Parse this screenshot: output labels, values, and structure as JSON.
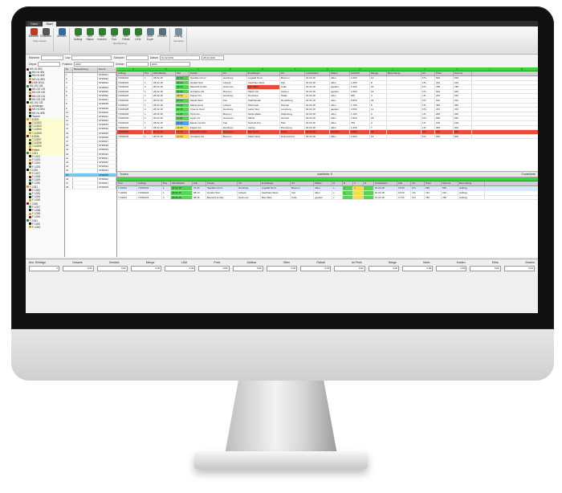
{
  "app": {
    "tabs": [
      "Datei",
      "Start"
    ],
    "active_tab": 1
  },
  "ribbon": {
    "groups": [
      {
        "name": "Stammdaten",
        "buttons": [
          {
            "label": "Benutzer",
            "icon": "user-icon",
            "color": "#c0392b"
          },
          {
            "label": "Einstellen",
            "icon": "settings-icon",
            "color": "#555555"
          }
        ]
      },
      {
        "name": "",
        "buttons": [
          {
            "label": "Abholen",
            "icon": "truck-icon",
            "color": "#2e6da4"
          }
        ]
      },
      {
        "name": "Bearbeitung",
        "buttons": [
          {
            "label": "Neu Auftrag",
            "icon": "truck-add-icon",
            "color": "#2e7d32"
          },
          {
            "label": "Neu Status",
            "icon": "truck-status-icon",
            "color": "#2e7d32"
          },
          {
            "label": "Neu Kunden",
            "icon": "truck-customer-icon",
            "color": "#2e7d32"
          },
          {
            "label": "Neu Tour",
            "icon": "truck-tour-icon",
            "color": "#2e7d32"
          },
          {
            "label": "Neu Fahrer",
            "icon": "truck-driver-icon",
            "color": "#2e7d32"
          },
          {
            "label": "Neu LKW",
            "icon": "truck-lkw-icon",
            "color": "#2e7d32"
          },
          {
            "label": "Auftr. Kopie",
            "icon": "copy-icon",
            "color": "#607d8b"
          },
          {
            "label": "Drucken",
            "icon": "print-icon",
            "color": "#546e7a"
          }
        ]
      },
      {
        "name": "Verwalten",
        "buttons": [
          {
            "label": "Auftrag",
            "icon": "tools-icon",
            "color": "#78909c"
          }
        ]
      }
    ]
  },
  "filters": {
    "row1": [
      {
        "label": "Rahmen",
        "value": ""
      },
      {
        "label": "Lkw",
        "value": ""
      },
      {
        "label": "Standort",
        "value": ""
      },
      {
        "label": "Datum",
        "value": "01.02.2019"
      },
      {
        "label": "",
        "value": "28.02.2019"
      }
    ],
    "row2": [
      {
        "label": "Depot",
        "value": ""
      },
      {
        "label": "Position",
        "value": "2000"
      },
      {
        "label": "Ordner",
        "value": ""
      },
      {
        "label": "",
        "value": "2000"
      }
    ]
  },
  "tree": {
    "nodes": [
      "NS-HL 890",
      "NS-HL 891",
      "NS-HL 892",
      "NS-HL 893",
      "LKW 6014",
      "NS-OS 128",
      "NS-OS 129",
      "NS-OS 130",
      "NS-OS 131",
      "NS-OS 132",
      "NS-OS 133",
      "Anhänger",
      "NS-HL 894",
      "NS-HL 895",
      "Touren",
      "T-10201",
      "T-10202",
      "T-10203",
      "T-10204",
      "T-10205",
      "T-10206",
      "T-10207",
      "T-10208",
      "T-10209",
      "Fahrer",
      "F-1021",
      "F-1022",
      "F-1023",
      "F-1024",
      "F-1025",
      "F-1026",
      "F-1027",
      "F-1028",
      "F-1029",
      "F-1030",
      "F-1031",
      "F-1032",
      "F-1033",
      "F-1034",
      "F-1035",
      "F-1036",
      "F-1037",
      "F-1038",
      "F-1039",
      "F-1040",
      "F-1041",
      "F-1042",
      "F-1043"
    ],
    "colors": [
      "#8b0000",
      "#2e7d32",
      "#000000",
      "#c8a400"
    ]
  },
  "midlist": {
    "headers": [
      "Nr",
      "Bezeichnung",
      "Kennz."
    ],
    "rows": [
      [
        "1",
        "",
        "ST98021"
      ],
      [
        "2",
        "",
        "ST98022"
      ],
      [
        "3",
        "",
        "ST98023"
      ],
      [
        "4",
        "",
        "ST98024"
      ],
      [
        "5",
        "",
        "ST98025"
      ],
      [
        "6",
        "",
        "ST98026"
      ],
      [
        "7",
        "",
        "ST98027"
      ],
      [
        "8",
        "",
        "ST98028"
      ],
      [
        "9",
        "",
        "ST98029"
      ],
      [
        "10",
        "",
        "ST98030"
      ],
      [
        "11",
        "",
        "ST98031"
      ],
      [
        "12",
        "",
        "ST98032"
      ],
      [
        "13",
        "",
        "ST98033"
      ],
      [
        "14",
        "",
        "ST98034"
      ],
      [
        "15",
        "",
        "ST98035"
      ],
      [
        "16",
        "",
        "ST98036"
      ],
      [
        "17",
        "",
        "ST98037"
      ],
      [
        "18",
        "",
        "ST98038"
      ],
      [
        "19",
        "",
        "ST98039"
      ],
      [
        "20",
        "",
        "ST98040"
      ],
      [
        "21",
        "",
        "ST98041"
      ],
      [
        "22",
        "",
        "ST98042"
      ],
      [
        "23",
        "",
        "ST98043"
      ],
      [
        "24",
        "",
        "ST98044"
      ],
      [
        "25",
        "",
        "ST98045"
      ],
      [
        "26",
        "",
        "ST98046"
      ],
      [
        "27",
        "",
        "ST98047"
      ],
      [
        "28",
        "",
        "ST98048"
      ]
    ]
  },
  "grid_top": {
    "band": [
      "A",
      "B",
      "C",
      "D",
      "E",
      "F",
      "G",
      "H",
      "I",
      "J",
      "K",
      "L",
      "M"
    ],
    "headers": [
      "Auftrag",
      "Pos",
      "Abholdatum",
      "Zeit",
      "Kunde",
      "Ort",
      "Empfänger",
      "Ort",
      "Lieferdatum",
      "Status",
      "Gewicht",
      "Menge",
      "Bemerkung",
      "Art",
      "Preis",
      "Summe"
    ],
    "rows": [
      {
        "cells": [
          "71000221",
          "1",
          "28.02.18",
          "07:30",
          "Spedition Kurz",
          "Hamburg",
          "Logistik Nord",
          "Bremen",
          "01.03.18",
          "offen",
          "2.400",
          "12",
          "",
          "FTL",
          "530",
          "530"
        ],
        "hl": {
          "3": "#5ad35a"
        }
      },
      {
        "cells": [
          "71000222",
          "1",
          "28.02.18",
          "08:10",
          "Handel Süd",
          "Lübeck",
          "Kaufhaus West",
          "Kiel",
          "01.03.18",
          "offen",
          "1.250",
          "8",
          "",
          "LTL",
          "310",
          "310"
        ],
        "hl": {
          "3": "#5ad35a"
        }
      },
      {
        "cells": [
          "71000223",
          "2",
          "28.02.18",
          "08:45",
          "Baustoff GmbH",
          "Hannover",
          "Bau Mitte",
          "Celle",
          "01.03.18",
          "geplant",
          "5.100",
          "20",
          "",
          "FTL",
          "780",
          "780"
        ],
        "hl": {
          "3": "#5ad35a",
          "6": "#e74c3c"
        }
      },
      {
        "cells": [
          "71000224",
          "1",
          "28.02.18",
          "09:00",
          "Getränke AG",
          "Bremen",
          "Markt Ost",
          "Verden",
          "01.03.18",
          "geplant",
          "3.300",
          "15",
          "",
          "FTL",
          "640",
          "640"
        ],
        "hl": {
          "3": "#5ad35a"
        }
      },
      {
        "cells": [
          "71000225",
          "1",
          "28.02.18",
          "09:30",
          "Papier KG",
          "Hamburg",
          "Druckerei",
          "Stade",
          "01.03.18",
          "offen",
          "900",
          "4",
          "",
          "LTL",
          "220",
          "220"
        ],
        "hl": {
          "3": "#f4e04d"
        }
      },
      {
        "cells": [
          "71000226",
          "3",
          "28.02.18",
          "10:00",
          "Metall Werk",
          "Kiel",
          "Stahlhandel",
          "Rendsburg",
          "02.03.18",
          "offen",
          "6.800",
          "24",
          "",
          "FTL",
          "910",
          "910"
        ],
        "hl": {
          "3": "#5ad35a"
        }
      },
      {
        "cells": [
          "71000227",
          "1",
          "28.02.18",
          "10:20",
          "Möbel Haus",
          "Lübeck",
          "Wohnwelt",
          "Wismar",
          "02.03.18",
          "offen",
          "1.700",
          "9",
          "",
          "LTL",
          "350",
          "350"
        ],
        "hl": {
          "3": "#5ad35a"
        }
      },
      {
        "cells": [
          "71000228",
          "2",
          "28.02.18",
          "10:45",
          "Chemie Nord",
          "Hamburg",
          "Labor Süd",
          "Lüneburg",
          "02.03.18",
          "geplant",
          "2.050",
          "11",
          "",
          "FTL",
          "470",
          "470"
        ],
        "hl": {
          "3": "#5ad35a"
        }
      },
      {
        "cells": [
          "71000229",
          "1",
          "28.02.18",
          "11:00",
          "Textil AG",
          "Bremen",
          "Mode Markt",
          "Oldenburg",
          "02.03.18",
          "offen",
          "1.100",
          "6",
          "",
          "LTL",
          "260",
          "260"
        ],
        "hl": {
          "3": "#5ad35a"
        }
      },
      {
        "cells": [
          "71000230",
          "1",
          "28.02.18",
          "11:30",
          "Agrar eG",
          "Hannover",
          "Mühle",
          "Hameln",
          "02.03.18",
          "offen",
          "4.400",
          "18",
          "",
          "FTL",
          "690",
          "690"
        ],
        "hl": {
          "3": "#5ad35a"
        }
      },
      {
        "cells": [
          "71000231",
          "1",
          "28.02.18",
          "12:00",
          "Elektro GmbH",
          "Kiel",
          "Technik Ost",
          "Plön",
          "02.03.18",
          "offen",
          "750",
          "3",
          "",
          "LTL",
          "190",
          "190"
        ],
        "hl": {
          "3": "#4aa8e8"
        }
      },
      {
        "cells": [
          "71000232",
          "2",
          "28.02.18",
          "12:30",
          "Papier KG",
          "Hamburg",
          "Verlag",
          "Pinneberg",
          "03.03.18",
          "offen",
          "1.350",
          "7",
          "",
          "LTL",
          "300",
          "300"
        ],
        "hl": {
          "3": "#f4e04d"
        }
      },
      {
        "cells": [
          "71000233",
          "1",
          "28.02.18",
          "13:00",
          "Baustoff GmbH",
          "Hannover",
          "Bau Nord",
          "Peine",
          "03.03.18",
          "storniert",
          "5.600",
          "22",
          "",
          "FTL",
          "820",
          "820"
        ],
        "row": "#e74c3c"
      },
      {
        "cells": [
          "71000234",
          "1",
          "28.02.18",
          "13:30",
          "Getränke AG",
          "Bremen",
          "Markt West",
          "Delmenhorst",
          "03.03.18",
          "offen",
          "2.900",
          "13",
          "",
          "FTL",
          "600",
          "600"
        ],
        "hl": {
          "3": "#f4e04d"
        }
      }
    ]
  },
  "section_bar": {
    "left": "Touren",
    "center": "markierte: 0",
    "right": "2 markierte"
  },
  "grid_bottom": {
    "headers": [
      "Tour",
      "Auftrag",
      "Pos",
      "Abholdatum",
      "Zeit",
      "Kunde",
      "Ort",
      "Empfänger",
      "Ort",
      "Status",
      "A",
      "B",
      "C",
      "D",
      "Lieferdatum",
      "Zeit",
      "Art",
      "Preis",
      "Summe",
      "Bemerkung"
    ],
    "rows": [
      {
        "cells": [
          "T-10201",
          "71000221",
          "1",
          "28.02.18",
          "07:30",
          "Spedition Kurz",
          "Hamburg",
          "Logistik Nord",
          "Bremen",
          "offen",
          "x",
          "x",
          "x",
          "",
          "01.03.18",
          "15:00",
          "FTL",
          "530",
          "530",
          "Auftrag"
        ],
        "hl": {
          "3": "#5ad35a",
          "11": "#5ad35a",
          "12": "#f4e04d",
          "13": "#5ad35a"
        }
      },
      {
        "cells": [
          "T-10202",
          "71000222",
          "1",
          "28.02.18",
          "08:10",
          "Handel Süd",
          "Lübeck",
          "Kaufhaus West",
          "Kiel",
          "offen",
          "x",
          "x",
          "",
          "",
          "01.03.18",
          "16:00",
          "LTL",
          "310",
          "310",
          "Auftrag"
        ],
        "hl": {
          "3": "#5ad35a",
          "11": "#5ad35a",
          "12": "#f4e04d",
          "13": "#5ad35a"
        }
      },
      {
        "cells": [
          "T-10203",
          "71000223",
          "2",
          "28.02.18",
          "08:45",
          "Baustoff GmbH",
          "Hannover",
          "Bau Mitte",
          "Celle",
          "geplant",
          "x",
          "",
          "",
          "",
          "01.03.18",
          "17:00",
          "FTL",
          "780",
          "780",
          "Auftrag"
        ],
        "hl": {
          "3": "#5ad35a",
          "11": "#5ad35a",
          "12": "#f4e04d",
          "13": "#5ad35a"
        }
      }
    ]
  },
  "summary": {
    "labels": [
      "Anz. Einträge",
      "Gesamt",
      "Gewicht",
      "Menge",
      "LDM",
      "Preis",
      "Zahlbar",
      "Offen",
      "Rabatt",
      "Ist Preis",
      "Marge",
      "Netto",
      "Kosten",
      "Erlös",
      "Gewinn"
    ],
    "values": [
      "0",
      "0,00",
      "0,00",
      "0,00",
      "0,00",
      "0,00",
      "0,00",
      "0,00",
      "0,00",
      "0,00",
      "0,00",
      "0,00",
      "0,00",
      "0,00",
      "0,00"
    ]
  }
}
